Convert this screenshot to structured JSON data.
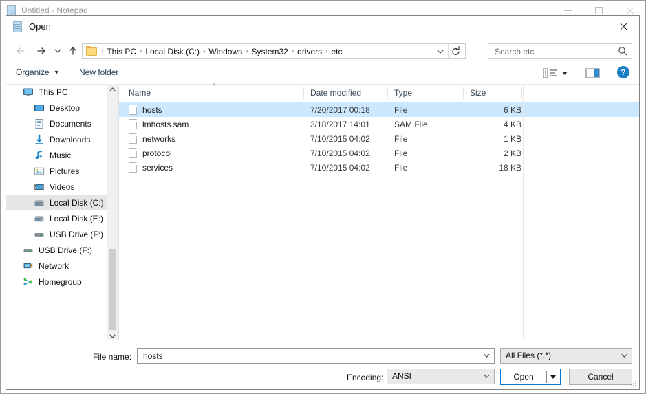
{
  "notepad": {
    "title": "Untitled - Notepad",
    "icon": "notepad-icon",
    "window_controls": {
      "minimize": "minimize-icon",
      "maximize": "maximize-icon",
      "close": "close-icon"
    }
  },
  "dialog": {
    "title": "Open",
    "icon": "notepad-icon",
    "close": "close-icon",
    "nav": {
      "back": "back-arrow-icon",
      "forward": "forward-arrow-icon",
      "recent": "chevron-down-icon",
      "up": "up-arrow-icon"
    },
    "address": {
      "folder_icon": "folder-icon",
      "breadcrumbs": [
        "This PC",
        "Local Disk (C:)",
        "Windows",
        "System32",
        "drivers",
        "etc"
      ],
      "separator": "›",
      "dropdown_icon": "chevron-down-icon",
      "refresh_icon": "refresh-icon"
    },
    "search": {
      "placeholder": "Search etc",
      "value": "",
      "icon": "search-icon"
    },
    "toolbar": {
      "organize_label": "Organize",
      "organize_caret": "▼",
      "new_folder_label": "New folder",
      "view_options_icon": "view-options-icon",
      "preview_pane_icon": "preview-pane-icon",
      "help_label": "?"
    },
    "sidebar": {
      "items": [
        {
          "label": "This PC",
          "icon": "computer-icon",
          "level": 0,
          "selected": false
        },
        {
          "label": "Desktop",
          "icon": "desktop-icon",
          "level": 1,
          "selected": false
        },
        {
          "label": "Documents",
          "icon": "documents-icon",
          "level": 1,
          "selected": false
        },
        {
          "label": "Downloads",
          "icon": "downloads-icon",
          "level": 1,
          "selected": false
        },
        {
          "label": "Music",
          "icon": "music-icon",
          "level": 1,
          "selected": false
        },
        {
          "label": "Pictures",
          "icon": "pictures-icon",
          "level": 1,
          "selected": false
        },
        {
          "label": "Videos",
          "icon": "videos-icon",
          "level": 1,
          "selected": false
        },
        {
          "label": "Local Disk (C:)",
          "icon": "hard-drive-icon",
          "level": 1,
          "selected": true
        },
        {
          "label": "Local Disk (E:)",
          "icon": "hard-drive-icon",
          "level": 1,
          "selected": false
        },
        {
          "label": "USB Drive (F:)",
          "icon": "usb-drive-icon",
          "level": 1,
          "selected": false
        },
        {
          "label": "USB Drive (F:)",
          "icon": "usb-drive-icon",
          "level": 0,
          "selected": false
        },
        {
          "label": "Network",
          "icon": "network-icon",
          "level": 0,
          "selected": false
        },
        {
          "label": "Homegroup",
          "icon": "homegroup-icon",
          "level": 0,
          "selected": false
        }
      ],
      "scrollbar": {
        "up_icon": "chevron-up-icon",
        "down_icon": "chevron-down-icon"
      }
    },
    "file_list": {
      "columns": [
        "Name",
        "Date modified",
        "Type",
        "Size"
      ],
      "sort_indicator": "˄",
      "rows": [
        {
          "name": "hosts",
          "date": "7/20/2017 00:18",
          "type": "File",
          "size": "6 KB",
          "icon": "file-icon",
          "selected": true
        },
        {
          "name": "lmhosts.sam",
          "date": "3/18/2017 14:01",
          "type": "SAM File",
          "size": "4 KB",
          "icon": "file-icon",
          "selected": false
        },
        {
          "name": "networks",
          "date": "7/10/2015 04:02",
          "type": "File",
          "size": "1 KB",
          "icon": "file-icon",
          "selected": false
        },
        {
          "name": "protocol",
          "date": "7/10/2015 04:02",
          "type": "File",
          "size": "2 KB",
          "icon": "file-icon",
          "selected": false
        },
        {
          "name": "services",
          "date": "7/10/2015 04:02",
          "type": "File",
          "size": "18 KB",
          "icon": "file-icon",
          "selected": false
        }
      ]
    },
    "footer": {
      "file_name_label": "File name:",
      "file_name_value": "hosts",
      "file_type_value": "All Files  (*.*)",
      "encoding_label": "Encoding:",
      "encoding_value": "ANSI",
      "open_label": "Open",
      "open_split_icon": "caret-down-icon",
      "cancel_label": "Cancel",
      "resize_grip": "resize-grip-icon"
    }
  },
  "colors": {
    "accent": "#0078d7",
    "selection": "#cce8ff",
    "sidebar_selection": "#e5e5e5",
    "help_blue": "#1b7fc4",
    "folder_yellow": "#fdd97f"
  }
}
